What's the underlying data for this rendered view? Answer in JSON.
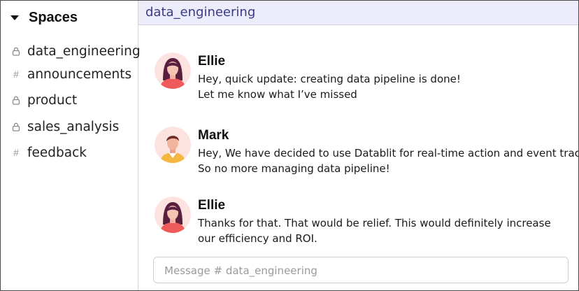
{
  "sidebar": {
    "title": "Spaces",
    "channels": [
      {
        "name": "data_engineering",
        "icon": "lock-icon"
      },
      {
        "name": "announcements",
        "icon": "hash-icon"
      },
      {
        "name": "product",
        "icon": "lock-icon"
      },
      {
        "name": "sales_analysis",
        "icon": "lock-icon"
      },
      {
        "name": "feedback",
        "icon": "hash-icon"
      }
    ]
  },
  "channel_header": {
    "title": "data_engineering"
  },
  "messages": [
    {
      "author": "Ellie",
      "avatar": "female-avatar",
      "lines": [
        "Hey, quick update: creating data pipeline is done!",
        "Let me know what I’ve missed"
      ]
    },
    {
      "author": "Mark",
      "avatar": "male-avatar",
      "lines": [
        "Hey, We have decided to use Datablit for real-time action and event tracking",
        "So no more managing data pipeline!"
      ]
    },
    {
      "author": "Ellie",
      "avatar": "female-avatar",
      "lines": [
        "Thanks for that. That would be relief. This would definitely increase",
        "our efficiency and ROI."
      ]
    }
  ],
  "composer": {
    "placeholder": "Message # data_engineering"
  },
  "colors": {
    "header_bg": "#ececfb",
    "header_text": "#3a3a8a",
    "avatar_bg": "#fde3df",
    "female_shirt": "#ef5a5a",
    "male_shirt": "#f5b740"
  }
}
